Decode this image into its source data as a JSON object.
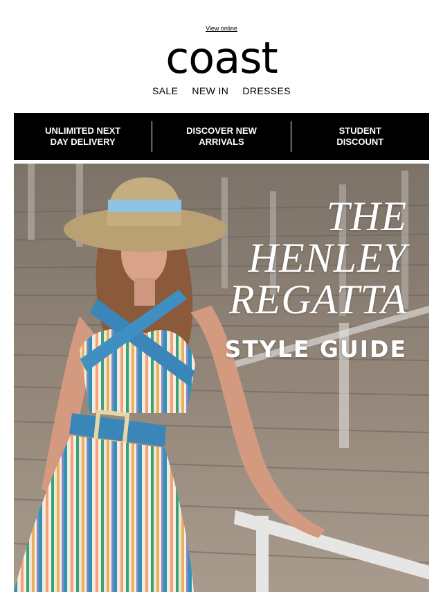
{
  "header": {
    "view_online": "View online",
    "logo": "coast"
  },
  "nav": {
    "items": [
      "SALE",
      "NEW IN",
      "DRESSES"
    ]
  },
  "promo": {
    "items": [
      "UNLIMITED NEXT DAY DELIVERY",
      "DISCOVER NEW ARRIVALS",
      "STUDENT DISCOUNT"
    ]
  },
  "hero": {
    "title_lines": [
      "THE",
      "HENLEY",
      "REGATTA"
    ],
    "subtitle": "STYLE GUIDE"
  },
  "colors": {
    "promo_bg": "#000000",
    "accent_blue": "#3a86b8",
    "stairs": "#8e8173"
  }
}
